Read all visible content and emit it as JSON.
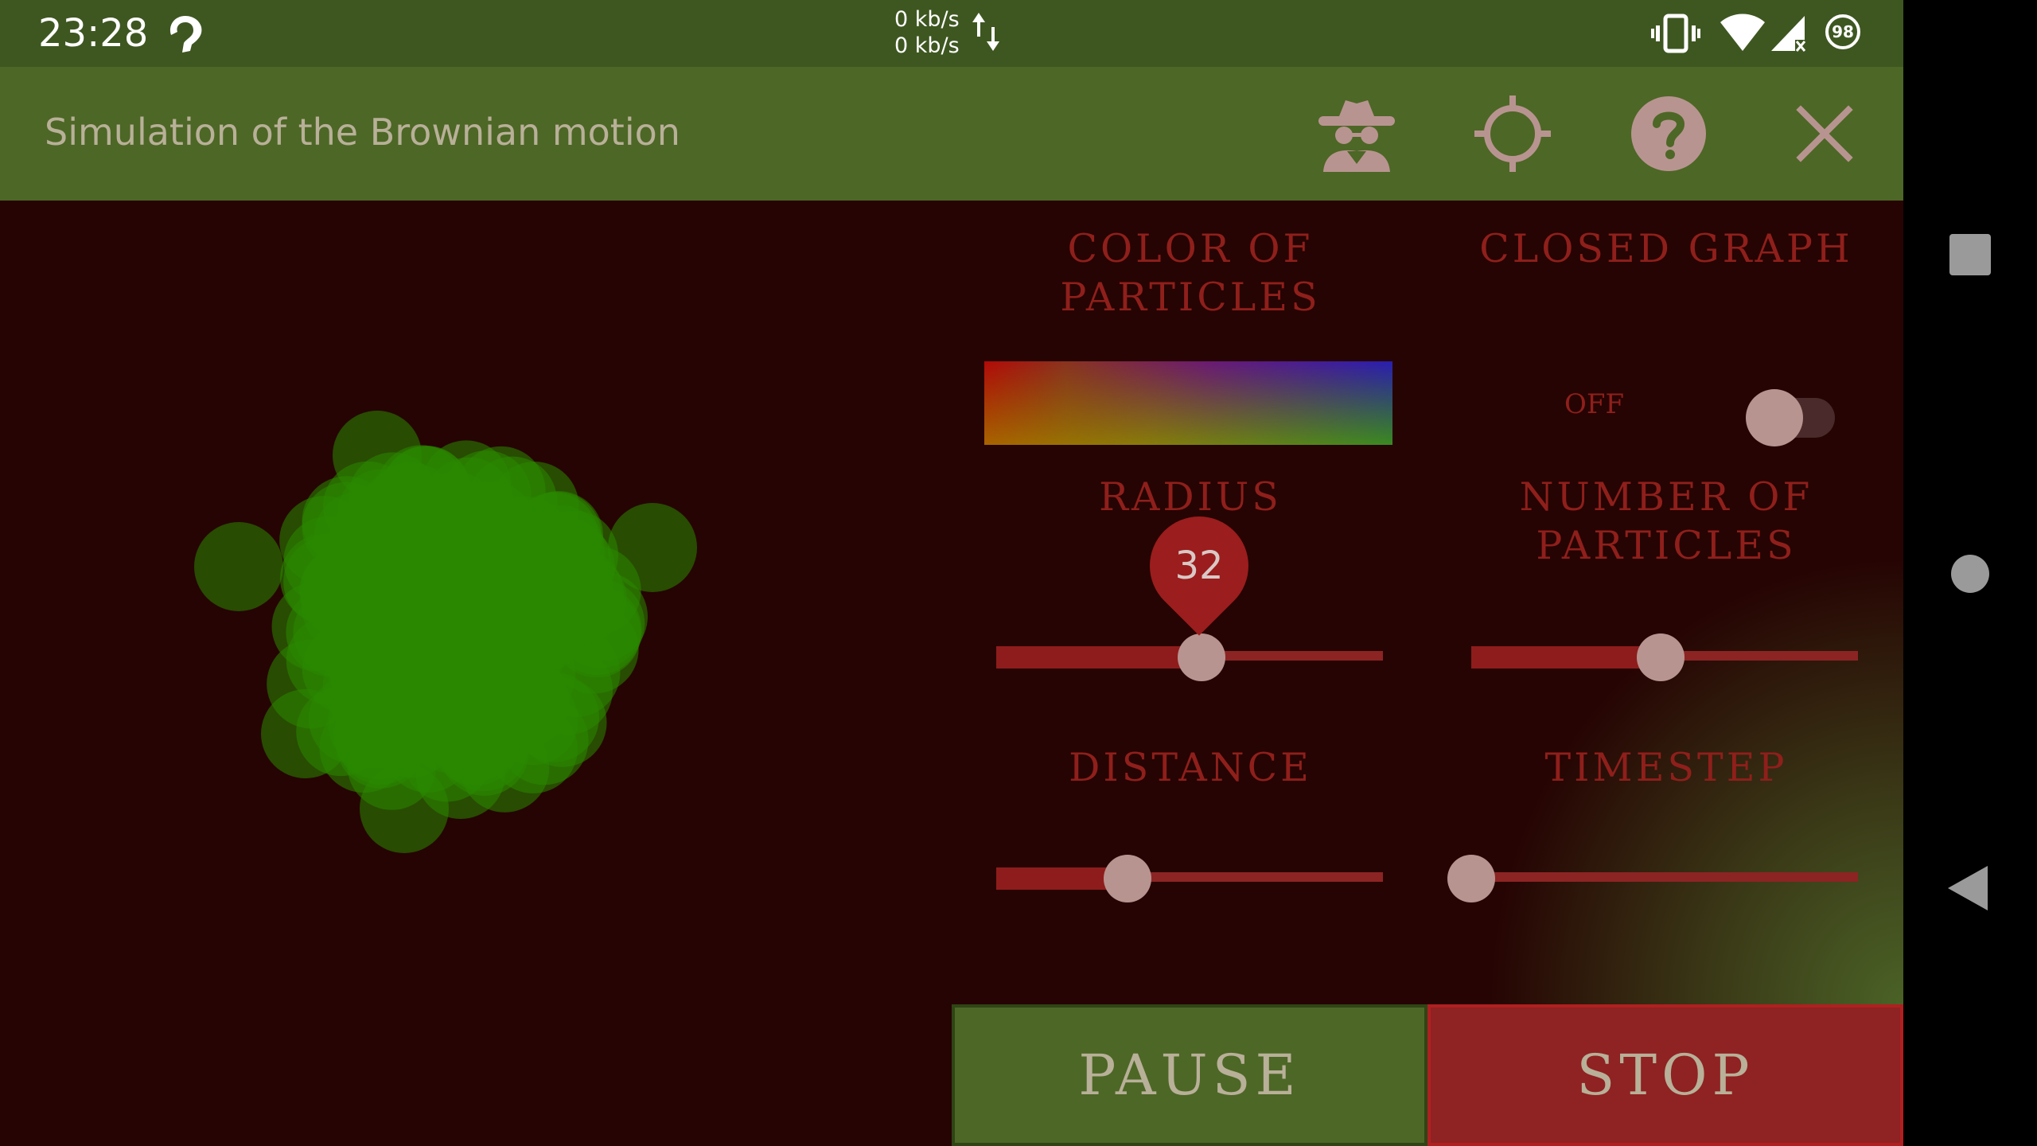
{
  "status_bar": {
    "time": "23:28",
    "net_upload": "0 kb/s",
    "net_download": "0 kb/s",
    "battery_level": "98",
    "icons": [
      "notification-icon",
      "data-arrows-icon",
      "vibrate-icon",
      "wifi-icon",
      "signal-icon",
      "battery-icon"
    ]
  },
  "toolbar": {
    "title": "Simulation of the Brownian motion",
    "actions": [
      "spy-icon",
      "crosshair-icon",
      "help-icon",
      "close-icon"
    ]
  },
  "controls": {
    "color_label": "COLOR OF PARTICLES",
    "closed_graph_label": "CLOSED GRAPH",
    "closed_graph_state": "OFF",
    "closed_graph_on": false,
    "radius_label": "RADIUS",
    "radius_value": "32",
    "radius_fraction": 0.53,
    "number_label": "NUMBER OF PARTICLES",
    "number_fraction": 0.49,
    "distance_label": "DISTANCE",
    "distance_fraction": 0.34,
    "timestep_label": "TIMESTEP",
    "timestep_fraction": 0.0
  },
  "buttons": {
    "pause": "PAUSE",
    "stop": "STOP"
  },
  "colors": {
    "particle": "#2a8800",
    "particle_edge": "#1f6e00",
    "background": "#260403",
    "toolbar": "#4d6726",
    "accent_red": "#8f1f1b"
  }
}
